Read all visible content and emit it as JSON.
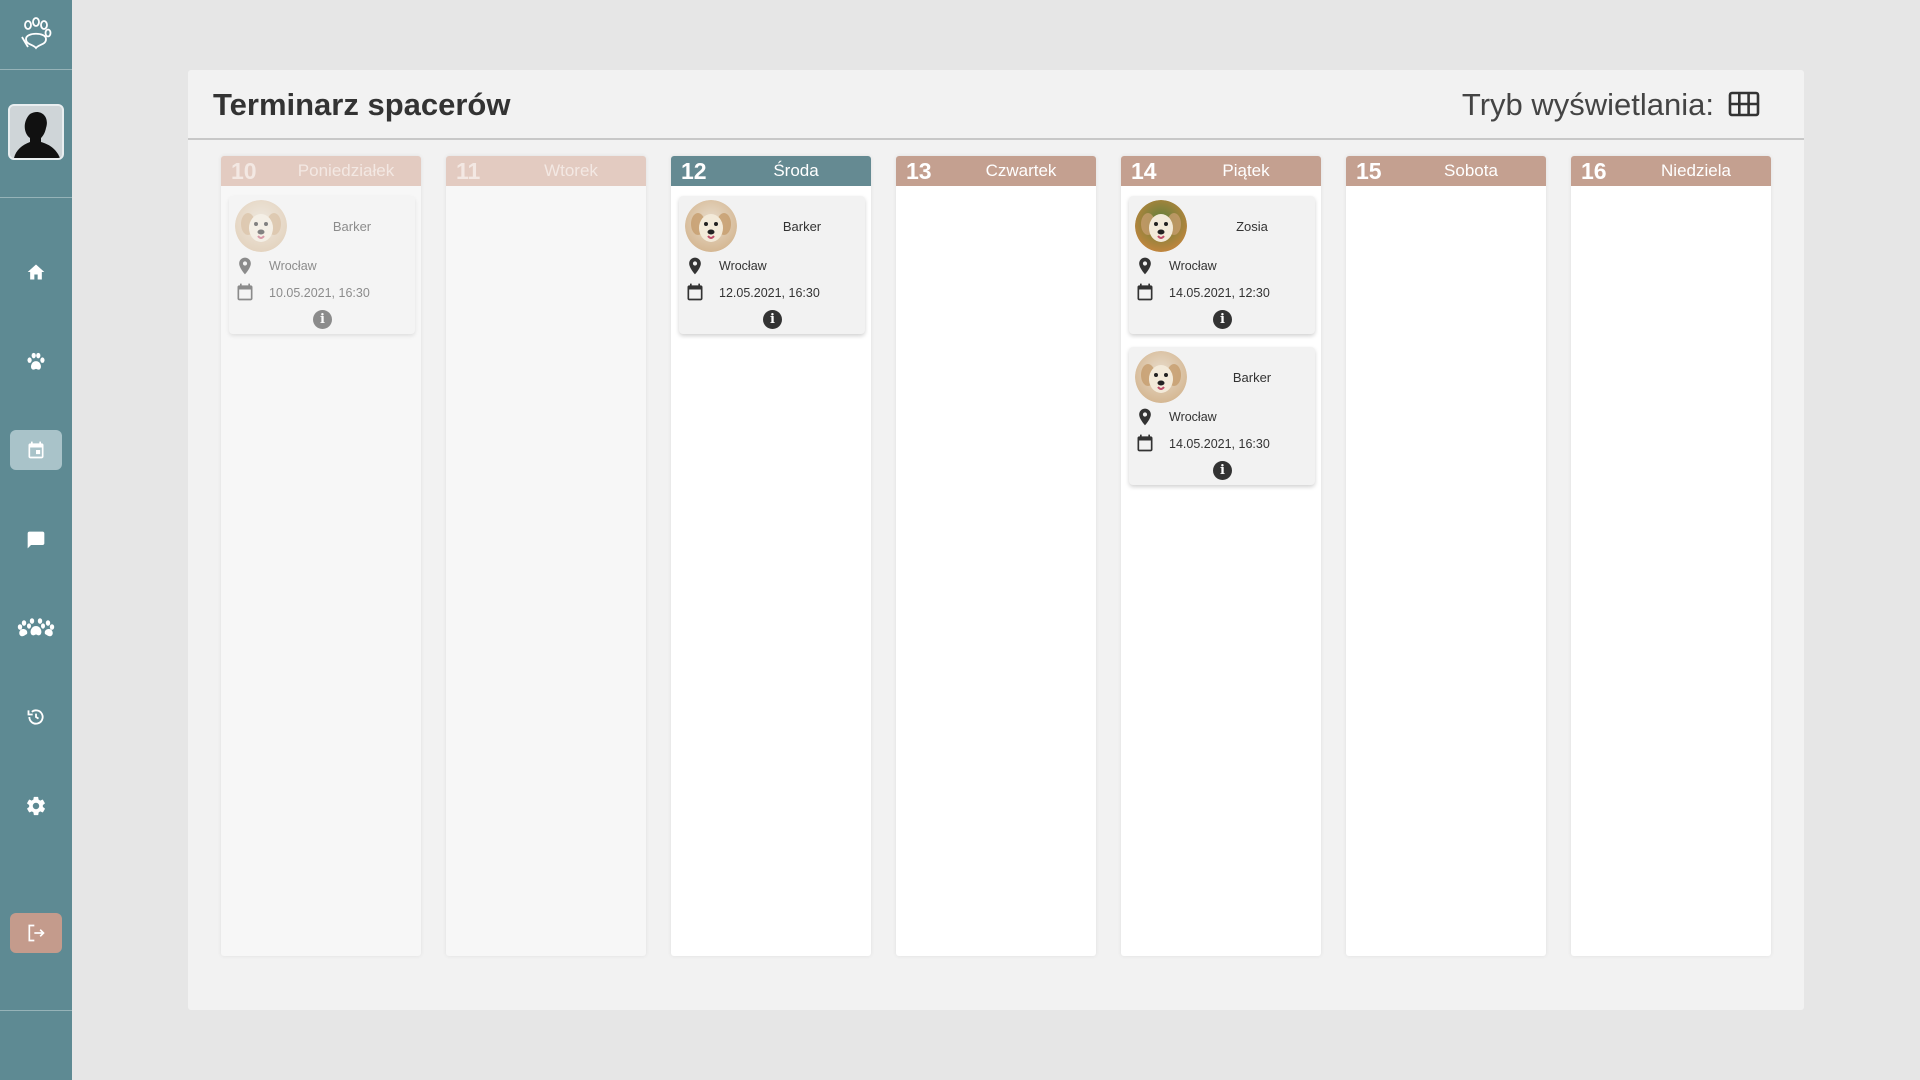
{
  "sidebar": {
    "logo": "paw-hand-logo",
    "avatar": "user-avatar",
    "items": [
      {
        "icon": "home-icon",
        "name": "home"
      },
      {
        "icon": "paw-icon",
        "name": "dogs"
      },
      {
        "icon": "calendar-icon",
        "name": "calendar",
        "active": true
      },
      {
        "icon": "chat-icon",
        "name": "messages"
      },
      {
        "icon": "paws-group-icon",
        "name": "walkers"
      },
      {
        "icon": "history-icon",
        "name": "history"
      },
      {
        "icon": "gear-icon",
        "name": "settings"
      }
    ],
    "logout_icon": "logout-icon"
  },
  "header": {
    "title": "Terminarz spacerów",
    "view_mode_label": "Tryb wyświetlania:",
    "view_mode_icon": "grid-icon"
  },
  "colors": {
    "sidebar": "#5e8a93",
    "day_header": "#c4a090",
    "day_header_today": "#658a92",
    "day_header_past": "#e3cbc1"
  },
  "days": [
    {
      "num": "10",
      "name": "Poniedziałek",
      "state": "past",
      "walks": [
        {
          "dog": "Barker",
          "city": "Wrocław",
          "datetime": "10.05.2021, 16:30"
        }
      ]
    },
    {
      "num": "11",
      "name": "Wtorek",
      "state": "past",
      "walks": []
    },
    {
      "num": "12",
      "name": "Środa",
      "state": "today",
      "walks": [
        {
          "dog": "Barker",
          "city": "Wrocław",
          "datetime": "12.05.2021, 16:30"
        }
      ]
    },
    {
      "num": "13",
      "name": "Czwartek",
      "state": "future",
      "walks": []
    },
    {
      "num": "14",
      "name": "Piątek",
      "state": "future",
      "walks": [
        {
          "dog": "Zosia",
          "city": "Wrocław",
          "datetime": "14.05.2021, 12:30"
        },
        {
          "dog": "Barker",
          "city": "Wrocław",
          "datetime": "14.05.2021, 16:30"
        }
      ]
    },
    {
      "num": "15",
      "name": "Sobota",
      "state": "future",
      "walks": []
    },
    {
      "num": "16",
      "name": "Niedziela",
      "state": "future",
      "walks": []
    }
  ]
}
